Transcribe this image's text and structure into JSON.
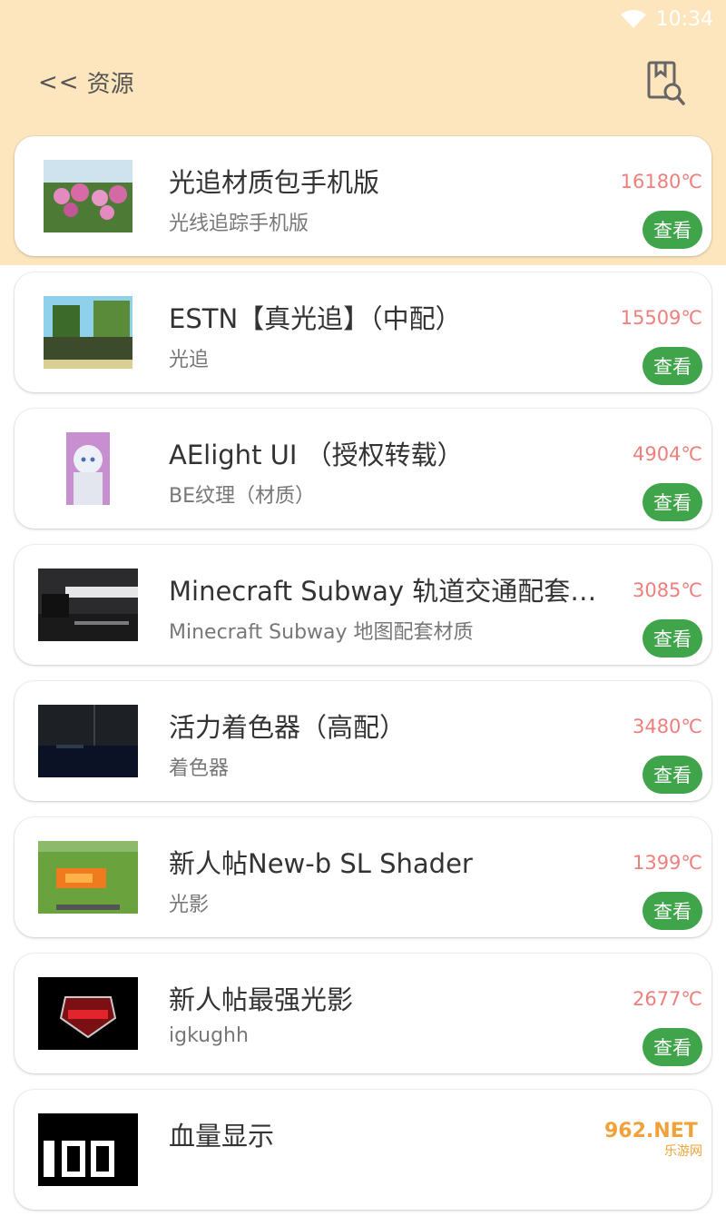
{
  "status_bar": {
    "time": "10:34",
    "wifi_icon": "wifi-icon"
  },
  "header": {
    "back_arrow": "<<",
    "title": "资源",
    "action_icon": "document-search-icon"
  },
  "button_label": "查看",
  "items": [
    {
      "title": "光追材质包手机版",
      "subtitle": "光线追踪手机版",
      "temperature": "16180℃",
      "thumb": "pink-flowers"
    },
    {
      "title": "ESTN【真光追】（中配）",
      "subtitle": "光追",
      "temperature": "15509℃",
      "thumb": "blocky-landscape"
    },
    {
      "title": "AElight UI （授权转载）",
      "subtitle": "BE纹理（材质）",
      "temperature": "4904℃",
      "thumb": "anime-girl"
    },
    {
      "title": "Minecraft Subway 轨道交通配套材质",
      "subtitle": "Minecraft Subway 地图配套材质",
      "temperature": "3085℃",
      "thumb": "subway-station"
    },
    {
      "title": "活力着色器（高配）",
      "subtitle": "着色器",
      "temperature": "3480℃",
      "thumb": "night-sky"
    },
    {
      "title": "新人帖New-b SL Shader",
      "subtitle": "光影",
      "temperature": "1399℃",
      "thumb": "grass-lava"
    },
    {
      "title": "新人帖最强光影",
      "subtitle": "igkughh",
      "temperature": "2677℃",
      "thumb": "red-logo"
    },
    {
      "title": "血量显示",
      "subtitle": "",
      "temperature": "",
      "thumb": "health-display"
    }
  ],
  "watermark": {
    "brand": "962.NET",
    "caption": "乐游网"
  },
  "colors": {
    "header": "#fde6bd",
    "accent_green": "#3fa44a",
    "temperature_red": "#ef7f7c"
  }
}
